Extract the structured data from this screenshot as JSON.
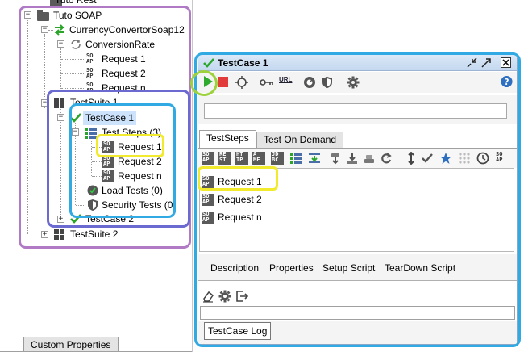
{
  "navigator": {
    "items": {
      "tuto_rest": "Tuto Rest",
      "tuto_soap": "Tuto SOAP",
      "interface": "CurrencyConvertorSoap12",
      "operation": "ConversionRate",
      "req1": "Request 1",
      "req2": "Request 2",
      "reqn": "Request n",
      "suite1": "TestSuite 1",
      "testcase1": "TestCase 1",
      "teststeps": "Test Steps (3)",
      "step_req1": "Request 1",
      "step_req2": "Request 2",
      "step_reqn": "Request n",
      "loadtests": "Load Tests (0)",
      "sectests": "Security Tests (0)",
      "testcase2": "TestCase 2",
      "suite2": "TestSuite 2"
    },
    "bottom_tab": "Custom Properties"
  },
  "testcase_window": {
    "title": "TestCase 1",
    "toolbar": {
      "url_label": "URL"
    },
    "search_value": "",
    "tabs": [
      "TestSteps",
      "Test On Demand"
    ],
    "steps": [
      "Request 1",
      "Request 2",
      "Request n"
    ],
    "props_tabs": [
      "Description",
      "Properties",
      "Setup Script",
      "TearDown Script"
    ],
    "log_tab": "TestCase Log"
  },
  "colors": {
    "highlight_purple": "#b07ac4",
    "highlight_indigo": "#6a6ad0",
    "highlight_cyan": "#31aae3",
    "highlight_yellow": "#f2ea2c",
    "highlight_lime": "#9dd23c",
    "run_green": "#2eaa2e",
    "stop_red": "#e23b3b",
    "check_green": "#2aa52a",
    "title_bg": "#c4d8ef"
  },
  "icons": {
    "run": "play-icon",
    "stop": "stop-icon",
    "options": "gear-icon",
    "help": "help-icon"
  }
}
